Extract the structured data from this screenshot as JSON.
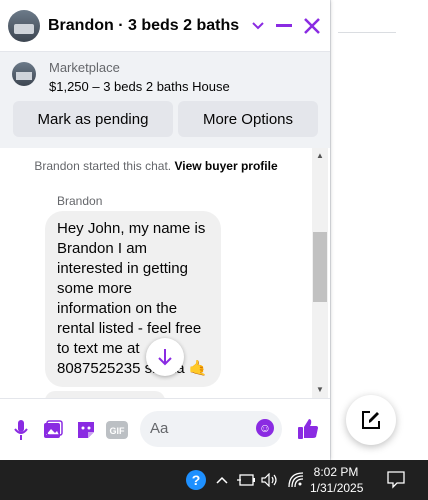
{
  "chat": {
    "title": "Brandon · 3 beds 2 baths ",
    "marketplace_label": "Marketplace",
    "listing_title": "$1,250 – 3 beds 2 baths House",
    "mark_pending_label": "Mark as pending",
    "more_options_label": "More Options"
  },
  "thread": {
    "system_text": "Brandon started this chat. ",
    "view_profile_label": "View buyer profile",
    "sender_name": "Brandon",
    "message": "Hey John, my name is Brandon I am interested in getting some more information on the rental listed - feel free to text me at 8087525235 shaka 🤙"
  },
  "composer": {
    "placeholder": "Aa"
  },
  "taskbar": {
    "time": "8:02 PM",
    "date": "1/31/2025"
  },
  "colors": {
    "accent": "#8a2be2",
    "taskbar": "#202020"
  }
}
